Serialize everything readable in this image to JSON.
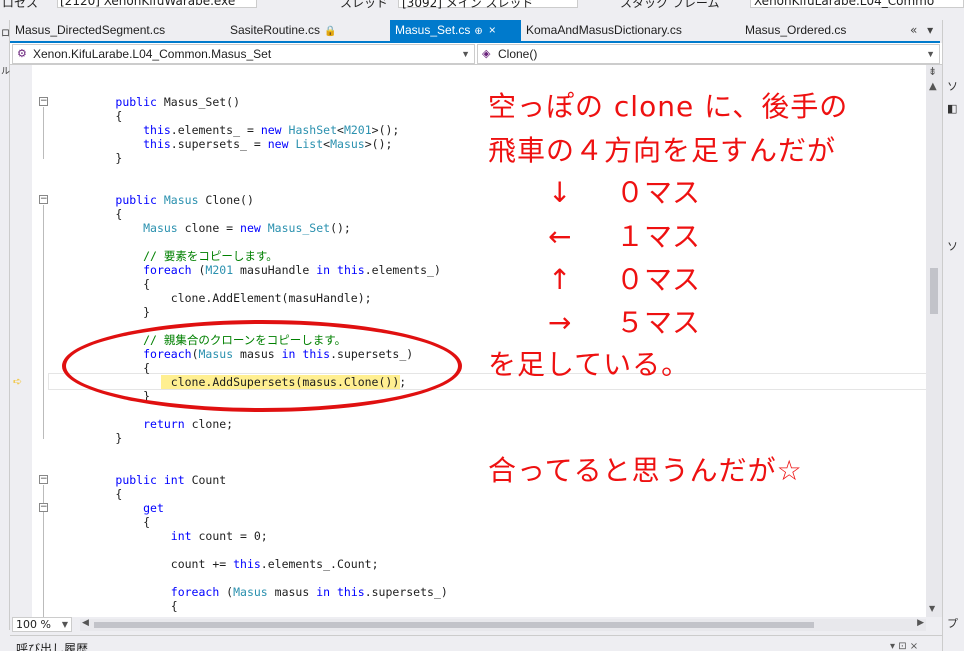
{
  "toolbar": {
    "fragments": [
      "ロセス",
      "[2120] XenonKifuWarabe.exe",
      "スレッド",
      "[3092] メイン スレッド",
      "スタック フレーム",
      "XenonKifuLarabe.L04_Commo"
    ]
  },
  "tabs": [
    {
      "label": "Masus_DirectedSegment.cs",
      "active": false
    },
    {
      "label": "SasiteRoutine.cs",
      "active": false,
      "pin": "🔒"
    },
    {
      "label": "Masus_Set.cs",
      "active": true,
      "pin": "⊕",
      "close": "×"
    },
    {
      "label": "KomaAndMasusDictionary.cs",
      "active": false
    },
    {
      "label": "Masus_Ordered.cs",
      "active": false
    }
  ],
  "tab_overflow": "«  ▾  ⚙",
  "navbar": {
    "class_selector": "Xenon.KifuLarabe.L04_Common.Masus_Set",
    "member_selector": "Clone()"
  },
  "code_lines": [
    [
      {
        "t": "        ",
        "c": "plain"
      },
      {
        "t": "public",
        "c": "kw"
      },
      {
        "t": " Masus_Set()",
        "c": "plain"
      }
    ],
    [
      {
        "t": "        {",
        "c": "plain"
      }
    ],
    [
      {
        "t": "            ",
        "c": "plain"
      },
      {
        "t": "this",
        "c": "kw"
      },
      {
        "t": ".elements_ = ",
        "c": "plain"
      },
      {
        "t": "new",
        "c": "kw"
      },
      {
        "t": " ",
        "c": "plain"
      },
      {
        "t": "HashSet",
        "c": "ty"
      },
      {
        "t": "<",
        "c": "plain"
      },
      {
        "t": "M201",
        "c": "ty"
      },
      {
        "t": ">();",
        "c": "plain"
      }
    ],
    [
      {
        "t": "            ",
        "c": "plain"
      },
      {
        "t": "this",
        "c": "kw"
      },
      {
        "t": ".supersets_ = ",
        "c": "plain"
      },
      {
        "t": "new",
        "c": "kw"
      },
      {
        "t": " ",
        "c": "plain"
      },
      {
        "t": "List",
        "c": "ty"
      },
      {
        "t": "<",
        "c": "plain"
      },
      {
        "t": "Masus",
        "c": "ty"
      },
      {
        "t": ">();",
        "c": "plain"
      }
    ],
    [
      {
        "t": "        }",
        "c": "plain"
      }
    ],
    [],
    [],
    [
      {
        "t": "        ",
        "c": "plain"
      },
      {
        "t": "public",
        "c": "kw"
      },
      {
        "t": " ",
        "c": "plain"
      },
      {
        "t": "Masus",
        "c": "ty"
      },
      {
        "t": " Clone()",
        "c": "plain"
      }
    ],
    [
      {
        "t": "        {",
        "c": "plain"
      }
    ],
    [
      {
        "t": "            ",
        "c": "plain"
      },
      {
        "t": "Masus",
        "c": "ty"
      },
      {
        "t": " clone = ",
        "c": "plain"
      },
      {
        "t": "new",
        "c": "kw"
      },
      {
        "t": " ",
        "c": "plain"
      },
      {
        "t": "Masus_Set",
        "c": "ty"
      },
      {
        "t": "();",
        "c": "plain"
      }
    ],
    [],
    [
      {
        "t": "            ",
        "c": "plain"
      },
      {
        "t": "// 要素をコピーします。",
        "c": "cm"
      }
    ],
    [
      {
        "t": "            ",
        "c": "plain"
      },
      {
        "t": "foreach",
        "c": "kw"
      },
      {
        "t": " (",
        "c": "plain"
      },
      {
        "t": "M201",
        "c": "ty"
      },
      {
        "t": " masuHandle ",
        "c": "plain"
      },
      {
        "t": "in",
        "c": "kw"
      },
      {
        "t": " ",
        "c": "plain"
      },
      {
        "t": "this",
        "c": "kw"
      },
      {
        "t": ".elements_)",
        "c": "plain"
      }
    ],
    [
      {
        "t": "            {",
        "c": "plain"
      }
    ],
    [
      {
        "t": "                clone.AddElement(masuHandle);",
        "c": "plain"
      }
    ],
    [
      {
        "t": "            }",
        "c": "plain"
      }
    ],
    [],
    [
      {
        "t": "            ",
        "c": "plain"
      },
      {
        "t": "// 親集合のクローンをコピーします。",
        "c": "cm"
      }
    ],
    [
      {
        "t": "            ",
        "c": "plain"
      },
      {
        "t": "foreach",
        "c": "kw"
      },
      {
        "t": "(",
        "c": "plain"
      },
      {
        "t": "Masus",
        "c": "ty"
      },
      {
        "t": " masus ",
        "c": "plain"
      },
      {
        "t": "in",
        "c": "kw"
      },
      {
        "t": " ",
        "c": "plain"
      },
      {
        "t": "this",
        "c": "kw"
      },
      {
        "t": ".supersets_)",
        "c": "plain"
      }
    ],
    [
      {
        "t": "            {",
        "c": "plain"
      }
    ],
    [
      {
        "t": "                clone.AddSupersets(masus.Clone());",
        "c": "plain"
      }
    ],
    [
      {
        "t": "            }",
        "c": "plain"
      }
    ],
    [],
    [
      {
        "t": "            ",
        "c": "plain"
      },
      {
        "t": "return",
        "c": "kw"
      },
      {
        "t": " clone;",
        "c": "plain"
      }
    ],
    [
      {
        "t": "        }",
        "c": "plain"
      }
    ],
    [],
    [],
    [
      {
        "t": "        ",
        "c": "plain"
      },
      {
        "t": "public",
        "c": "kw"
      },
      {
        "t": " ",
        "c": "plain"
      },
      {
        "t": "int",
        "c": "kw"
      },
      {
        "t": " Count",
        "c": "plain"
      }
    ],
    [
      {
        "t": "        {",
        "c": "plain"
      }
    ],
    [
      {
        "t": "            ",
        "c": "plain"
      },
      {
        "t": "get",
        "c": "kw"
      }
    ],
    [
      {
        "t": "            {",
        "c": "plain"
      }
    ],
    [
      {
        "t": "                ",
        "c": "plain"
      },
      {
        "t": "int",
        "c": "kw"
      },
      {
        "t": " count = 0;",
        "c": "plain"
      }
    ],
    [],
    [
      {
        "t": "                count += ",
        "c": "plain"
      },
      {
        "t": "this",
        "c": "kw"
      },
      {
        "t": ".elements_.Count;",
        "c": "plain"
      }
    ],
    [],
    [
      {
        "t": "                ",
        "c": "plain"
      },
      {
        "t": "foreach",
        "c": "kw"
      },
      {
        "t": " (",
        "c": "plain"
      },
      {
        "t": "Masus",
        "c": "ty"
      },
      {
        "t": " masus ",
        "c": "plain"
      },
      {
        "t": "in",
        "c": "kw"
      },
      {
        "t": " ",
        "c": "plain"
      },
      {
        "t": "this",
        "c": "kw"
      },
      {
        "t": ".supersets_)",
        "c": "plain"
      }
    ],
    [
      {
        "t": "                {",
        "c": "plain"
      }
    ]
  ],
  "annotation": {
    "line1": "空っぽの clone に、後手の",
    "line2": "飛車の４方向を足すんだが",
    "directions": [
      {
        "arrow": "↓",
        "count": "０マス"
      },
      {
        "arrow": "←",
        "count": "１マス"
      },
      {
        "arrow": "↑",
        "count": "０マス"
      },
      {
        "arrow": "→",
        "count": "５マス"
      }
    ],
    "line3": "を足している。",
    "line4": "合ってると思うんだが☆",
    "color": "#ee1111"
  },
  "zoom": "100 %",
  "bottom_panel": {
    "title": "呼び出し履歴",
    "controls": "▾ ⊡ ×"
  },
  "right_panel_glyphs": [
    "ソ",
    "◧",
    "ソ",
    "プ"
  ],
  "left_panel_glyphs": [
    "ロ",
    "ル"
  ]
}
